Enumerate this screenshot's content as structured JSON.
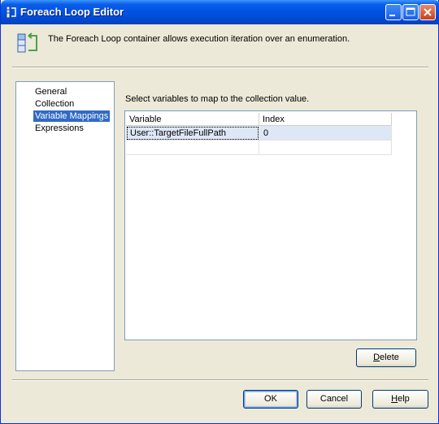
{
  "window": {
    "title": "Foreach Loop Editor"
  },
  "banner": {
    "icon": "foreach-loop-icon",
    "text": "The Foreach Loop container allows execution iteration over an enumeration."
  },
  "nav": {
    "items": [
      {
        "label": "General",
        "selected": false
      },
      {
        "label": "Collection",
        "selected": false
      },
      {
        "label": "Variable Mappings",
        "selected": true
      },
      {
        "label": "Expressions",
        "selected": false
      }
    ]
  },
  "main": {
    "instruction": "Select variables to map to the collection value.",
    "grid": {
      "columns": [
        "Variable",
        "Index"
      ],
      "rows": [
        [
          "User::TargetFileFullPath",
          "0"
        ],
        [
          "",
          ""
        ]
      ]
    }
  },
  "buttons": {
    "delete": {
      "mnemonic": "D",
      "rest": "elete"
    },
    "ok": "OK",
    "cancel": "Cancel",
    "help": {
      "mnemonic": "H",
      "rest": "elp"
    }
  },
  "colors": {
    "titlebar": "#0054e3",
    "dialog_bg": "#ece9d8",
    "selection": "#316ac5",
    "grid_selected_row": "#dee7f5"
  }
}
